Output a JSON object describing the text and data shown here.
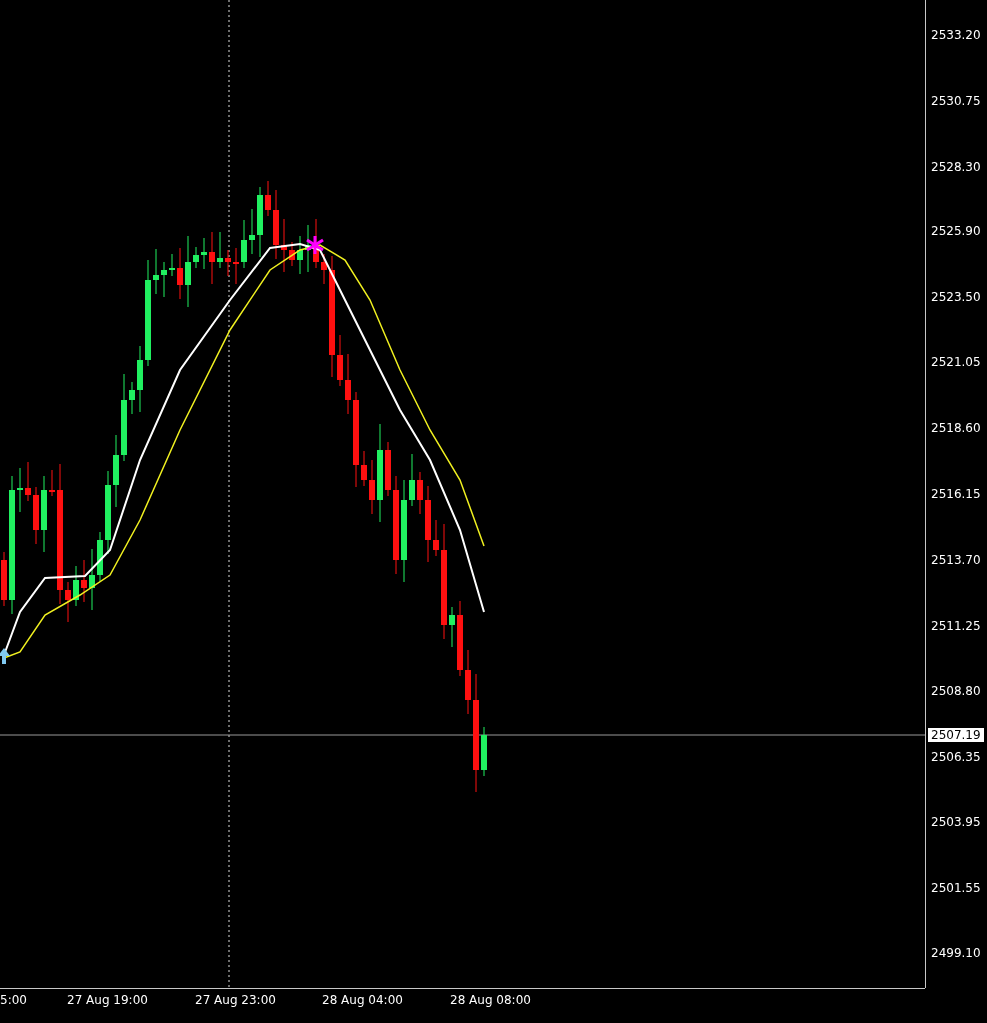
{
  "price_axis": {
    "labels": [
      "2533.20",
      "2530.75",
      "2528.30",
      "2525.90",
      "2523.50",
      "2521.05",
      "2518.60",
      "2516.15",
      "2513.70",
      "2511.25",
      "2508.80",
      "2506.35",
      "2503.95",
      "2501.55",
      "2499.10"
    ]
  },
  "current_price": {
    "label": "2507.19"
  },
  "time_axis": {
    "labels": [
      "5:00",
      "27 Aug 19:00",
      "27 Aug 23:00",
      "28 Aug 04:00",
      "28 Aug 08:00"
    ]
  }
}
